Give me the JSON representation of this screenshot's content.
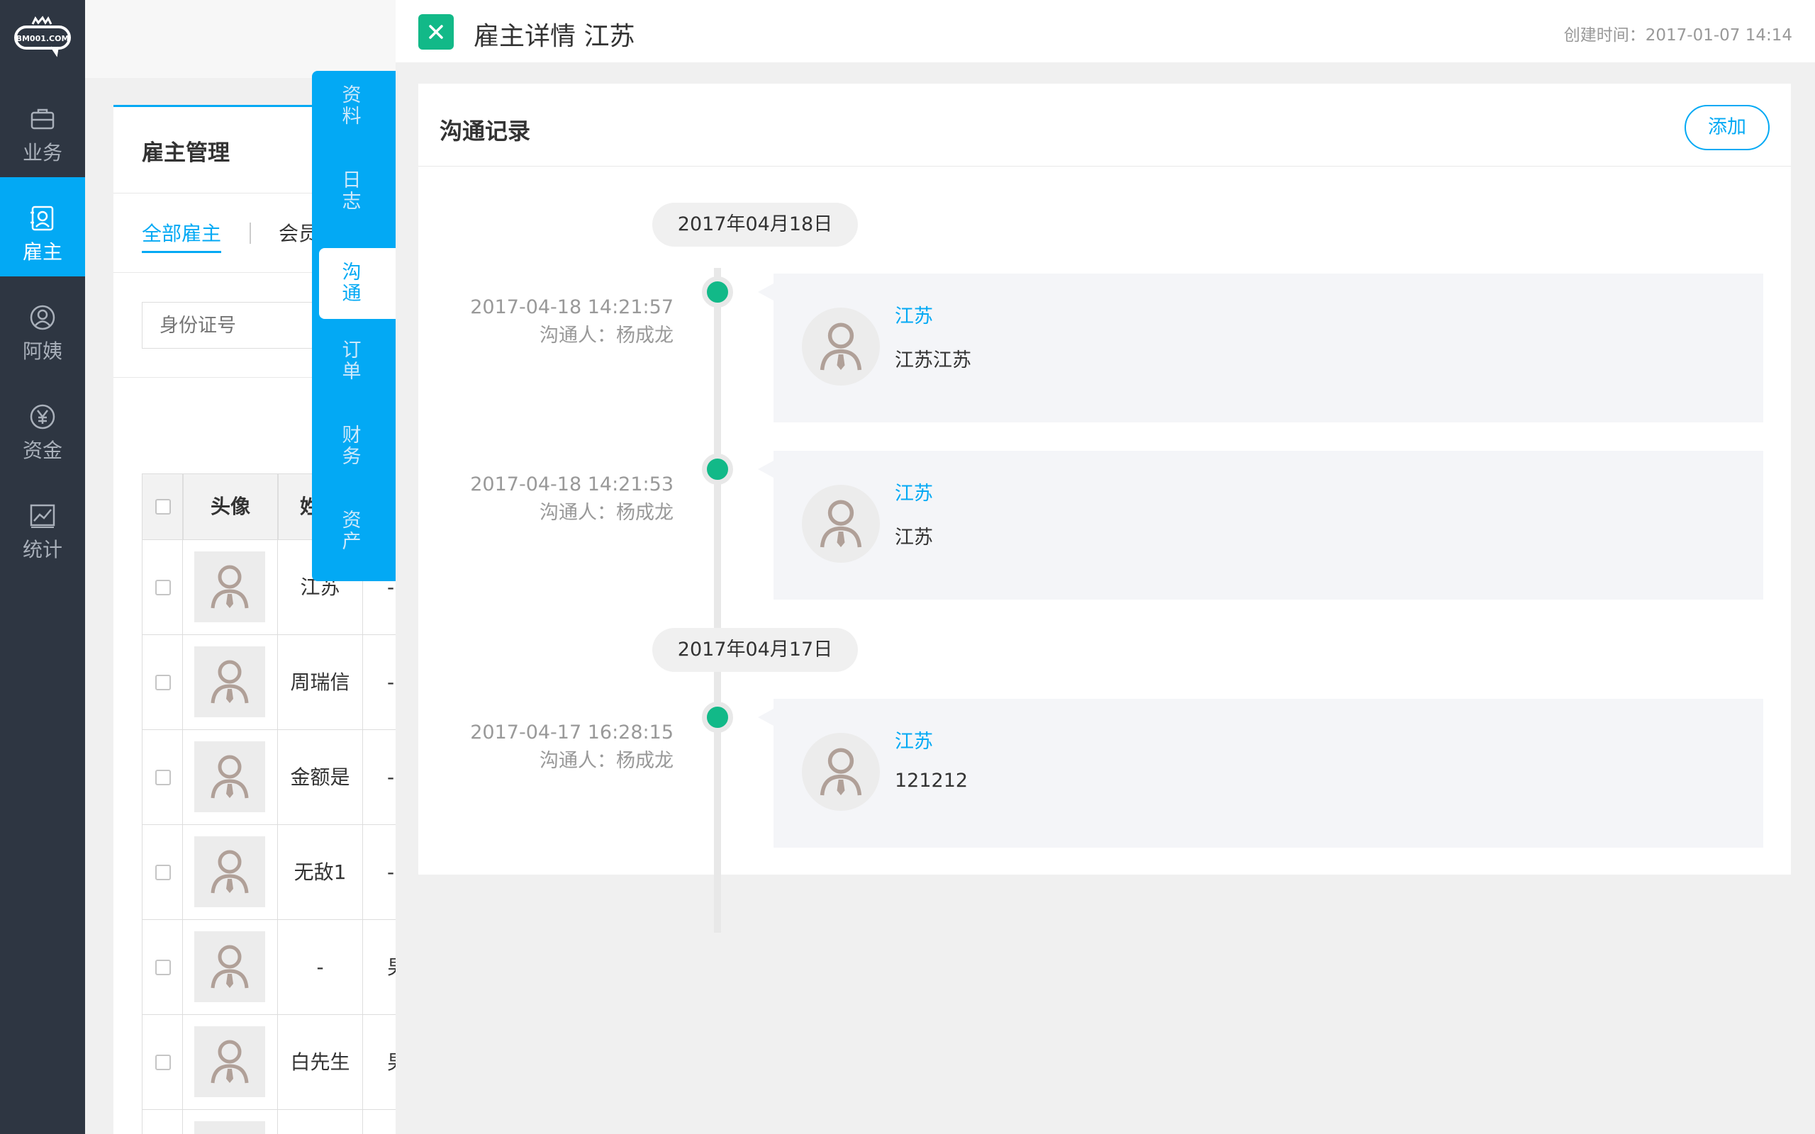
{
  "sidebar": {
    "logo_text": "BM001.COM",
    "items": [
      {
        "label": "业务",
        "icon": "briefcase-icon",
        "active": false
      },
      {
        "label": "雇主",
        "icon": "employer-card-icon",
        "active": true
      },
      {
        "label": "阿姨",
        "icon": "user-circle-icon",
        "active": false
      },
      {
        "label": "资金",
        "icon": "yen-icon",
        "active": false
      },
      {
        "label": "统计",
        "icon": "chart-icon",
        "active": false
      }
    ]
  },
  "background_page": {
    "title": "雇主管理",
    "tabs": [
      "全部雇主",
      "会员"
    ],
    "search_placeholder": "身份证号",
    "table": {
      "headers": [
        "头像",
        "姓"
      ],
      "rows": [
        {
          "name": "江苏",
          "extra": "-"
        },
        {
          "name": "周瑞信",
          "extra": "-"
        },
        {
          "name": "金额是",
          "extra": "-"
        },
        {
          "name": "无敌1",
          "extra": "-"
        },
        {
          "name": "-",
          "extra": "男"
        },
        {
          "name": "白先生",
          "extra": "男"
        }
      ]
    }
  },
  "side_tabs": [
    {
      "label": "资料",
      "active": false
    },
    {
      "label": "日志",
      "active": false
    },
    {
      "label": "沟通",
      "active": true
    },
    {
      "label": "订单",
      "active": false
    },
    {
      "label": "财务",
      "active": false
    },
    {
      "label": "资产",
      "active": false
    }
  ],
  "panel": {
    "title": "雇主详情 江苏",
    "created_label": "创建时间：",
    "created_value": "2017-01-07 14:14",
    "card_title": "沟通记录",
    "add_label": "添加",
    "groups": [
      {
        "date": "2017年04月18日",
        "records": [
          {
            "time": "2017-04-18 14:21:57",
            "contact": "沟通人：杨成龙",
            "name": "江苏",
            "text": "江苏江苏"
          },
          {
            "time": "2017-04-18 14:21:53",
            "contact": "沟通人：杨成龙",
            "name": "江苏",
            "text": "江苏"
          }
        ]
      },
      {
        "date": "2017年04月17日",
        "records": [
          {
            "time": "2017-04-17 16:28:15",
            "contact": "沟通人：杨成龙",
            "name": "江苏",
            "text": "121212"
          }
        ]
      }
    ]
  },
  "colors": {
    "sidebar_bg": "#2e3642",
    "accent": "#03a9f4",
    "green": "#12b988"
  }
}
